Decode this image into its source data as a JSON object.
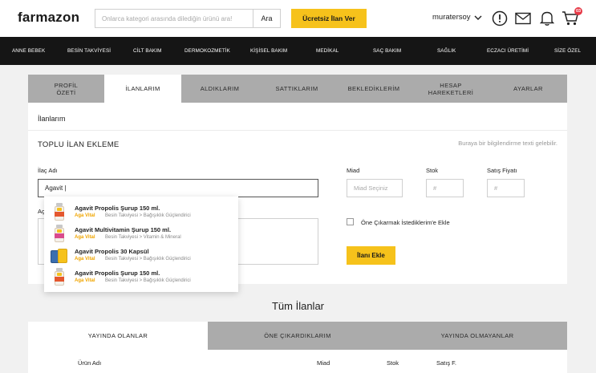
{
  "header": {
    "logo": "farmazon",
    "search_placeholder": "Onlarca kategori arasında dilediğin ürünü ara!",
    "search_button": "Ara",
    "cta": "Ücretsiz İlan Ver",
    "username": "muratersoy",
    "cart_count": "03"
  },
  "nav": [
    "ANNE BEBEK",
    "BESİN TAKVİYESİ",
    "CİLT BAKIM",
    "DERMOKOZMETİK",
    "KİŞİSEL BAKIM",
    "MEDİKAL",
    "SAÇ BAKIM",
    "SAĞLIK",
    "ECZACI ÜRETİMİ",
    "SİZE ÖZEL"
  ],
  "profile_tabs": [
    {
      "l1": "PROFİL",
      "l2": "ÖZETİ"
    },
    {
      "l1": "İLANLARIM",
      "l2": ""
    },
    {
      "l1": "ALDIKLARIM",
      "l2": ""
    },
    {
      "l1": "SATTIKLARIM",
      "l2": ""
    },
    {
      "l1": "BEKLEDİKLERİM",
      "l2": ""
    },
    {
      "l1": "HESAP",
      "l2": "HAREKETLERİ"
    },
    {
      "l1": "AYARLAR",
      "l2": ""
    }
  ],
  "active_tab": 1,
  "form": {
    "section_title": "İlanlarım",
    "bulk_title": "TOPLU İLAN EKLEME",
    "info_text": "Buraya bir bilgilendirme texti gelebilir.",
    "drug_label": "İlaç Adı",
    "drug_value": "Agavit |",
    "desc_label": "Açıklama",
    "date_label": "Miad",
    "date_placeholder": "Miad Seçiniz",
    "stock_label": "Stok",
    "stock_placeholder": "#",
    "price_label": "Satış Fiyatı",
    "price_placeholder": "#",
    "feature_label": "Öne Çıkarmak İstediklerim'e Ekle",
    "submit_label": "İlanı Ekle"
  },
  "suggestions": [
    {
      "name": "Agavit Propolis Şurup 150 ml.",
      "brand": "Aga Vital",
      "category": "Besin Takviyesi > Bağışıklık Güçlendirici"
    },
    {
      "name": "Agavit Multivitamin Şurup 150 ml.",
      "brand": "Aga Vital",
      "category": "Besin Takviyesi > Vitamin & Mineral"
    },
    {
      "name": "Agavit Propolis 30 Kapsül",
      "brand": "Aga Vital",
      "category": "Besin Takviyesi > Bağışıklık Güçlendirici"
    },
    {
      "name": "Agavit Propolis Şurup 150 ml.",
      "brand": "Aga Vital",
      "category": "Besin Takviyesi > Bağışıklık Güçlendirici"
    }
  ],
  "listings": {
    "title": "Tüm İlanlar",
    "tabs": [
      "YAYINDA OLANLAR",
      "ÖNE ÇIKARDIKLARIM",
      "YAYINDA OLMAYANLAR"
    ],
    "columns": [
      "Ürün Adı",
      "Miad",
      "Stok",
      "Satış F."
    ]
  },
  "colors": {
    "accent": "#f6c21b",
    "nav_bg": "#151515",
    "tab_bg": "#ababab",
    "brand_text": "#f0a500",
    "badge": "#e63946"
  }
}
